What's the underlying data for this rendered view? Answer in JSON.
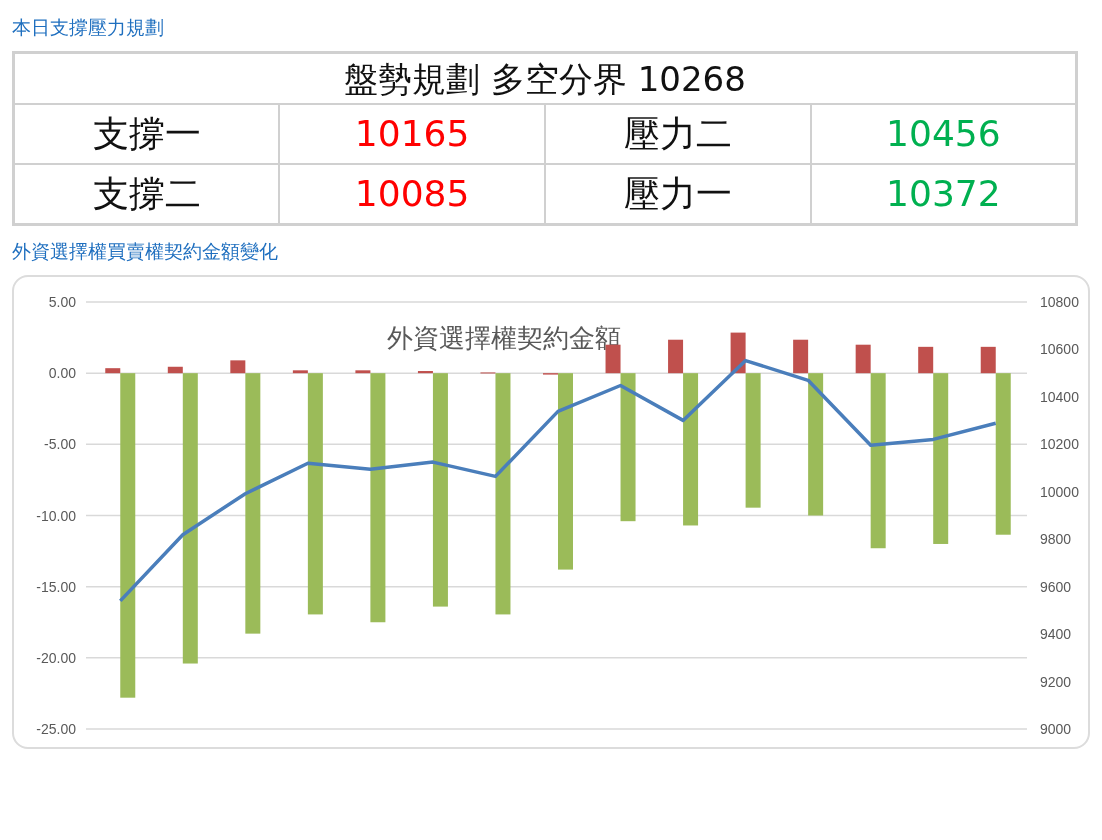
{
  "plan_heading": "本日支撐壓力規劃",
  "plan_table": {
    "title": "盤勢規劃 多空分界 10268",
    "rows": [
      [
        {
          "text": "支撐一",
          "kind": "label"
        },
        {
          "text": "10165",
          "kind": "support"
        },
        {
          "text": "壓力二",
          "kind": "label"
        },
        {
          "text": "10456",
          "kind": "resistance"
        }
      ],
      [
        {
          "text": "支撐二",
          "kind": "label"
        },
        {
          "text": "10085",
          "kind": "support"
        },
        {
          "text": "壓力一",
          "kind": "label"
        },
        {
          "text": "10372",
          "kind": "resistance"
        }
      ]
    ]
  },
  "chart_heading": "外資選擇權買賣權契約金額變化",
  "chart": {
    "chart_data": {
      "type": "bar",
      "title": "外資選擇權契約金額",
      "stacked": false,
      "grid": true,
      "ylim": [
        -25,
        5
      ],
      "yticks": [
        {
          "value": 5,
          "label": "5.00"
        },
        {
          "value": 0,
          "label": "0.00"
        },
        {
          "value": -5,
          "label": "-5.00"
        },
        {
          "value": -10,
          "label": "-10.00"
        },
        {
          "value": -15,
          "label": "-15.00"
        },
        {
          "value": -20,
          "label": "-20.00"
        },
        {
          "value": -25,
          "label": "-25.00"
        }
      ],
      "y2lim": [
        9000,
        10800
      ],
      "y2ticks": [
        {
          "value": 10800,
          "label": "10800"
        },
        {
          "value": 10600,
          "label": "10600"
        },
        {
          "value": 10400,
          "label": "10400"
        },
        {
          "value": 10200,
          "label": "10200"
        },
        {
          "value": 10000,
          "label": "10000"
        },
        {
          "value": 9800,
          "label": "9800"
        },
        {
          "value": 9600,
          "label": "9600"
        },
        {
          "value": 9400,
          "label": "9400"
        },
        {
          "value": 9200,
          "label": "9200"
        },
        {
          "value": 9000,
          "label": "9000"
        }
      ],
      "series": [
        {
          "color": "#c0504d",
          "values": [
            0.35,
            0.45,
            0.9,
            0.2,
            0.2,
            0.15,
            0.05,
            -0.1,
            2.0,
            2.35,
            2.85,
            2.35,
            2.0,
            1.85,
            1.85
          ]
        },
        {
          "color": "#9bbb59",
          "values": [
            -22.8,
            -20.4,
            -18.3,
            -16.95,
            -17.5,
            -16.4,
            -16.95,
            -13.8,
            -10.4,
            -10.7,
            -9.45,
            -10.0,
            -12.3,
            -12.0,
            -11.35
          ]
        },
        {
          "type": "line",
          "axis": "y2",
          "color": "#4a7ebb",
          "values": [
            9540,
            9819,
            9992,
            10120,
            10095,
            10125,
            10065,
            10339,
            10448,
            10301,
            10553,
            10470,
            10196,
            10221,
            10289
          ]
        }
      ]
    }
  }
}
